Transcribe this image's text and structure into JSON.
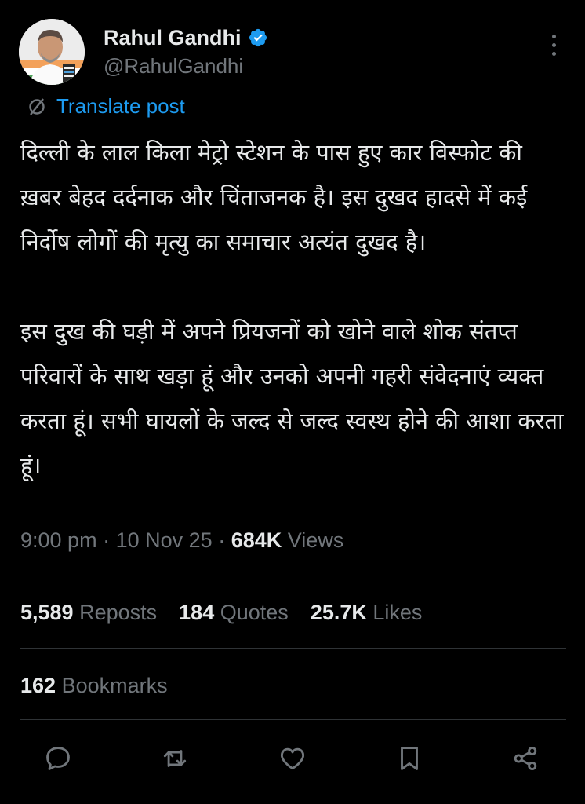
{
  "author": {
    "display_name": "Rahul Gandhi",
    "handle": "@RahulGandhi",
    "verified": true
  },
  "translate": {
    "label": "Translate post"
  },
  "post": {
    "paragraphs": [
      "दिल्ली के लाल किला मेट्रो स्टेशन के पास हुए कार विस्फोट की ख़बर बेहद दर्दनाक और चिंताजनक है। इस दुखद हादसे में कई निर्दोष लोगों की मृत्यु का समाचार अत्यंत दुखद है।",
      "इस दुख की घड़ी में अपने प्रियजनों को खोने वाले शोक संतप्त परिवारों के साथ खड़ा हूं और उनको अपनी गहरी संवेदनाएं व्यक्त करता हूं। सभी घायलों के जल्द से जल्द स्वस्थ होने की आशा करता हूं।"
    ]
  },
  "meta": {
    "time": "9:00 pm",
    "date": "10 Nov 25",
    "separator": "·",
    "views_count": "684K",
    "views_label": "Views"
  },
  "stats": {
    "reposts": {
      "count": "5,589",
      "label": "Reposts"
    },
    "quotes": {
      "count": "184",
      "label": "Quotes"
    },
    "likes": {
      "count": "25.7K",
      "label": "Likes"
    },
    "bookmarks": {
      "count": "162",
      "label": "Bookmarks"
    }
  },
  "actions": [
    "reply-icon",
    "repost-icon",
    "like-icon",
    "bookmark-icon",
    "share-icon"
  ],
  "colors": {
    "background": "#000000",
    "text": "#e7e9ea",
    "muted": "#71767b",
    "link": "#1d9bf0",
    "divider": "#2f3336",
    "verified_badge": "#1d9bf0"
  }
}
